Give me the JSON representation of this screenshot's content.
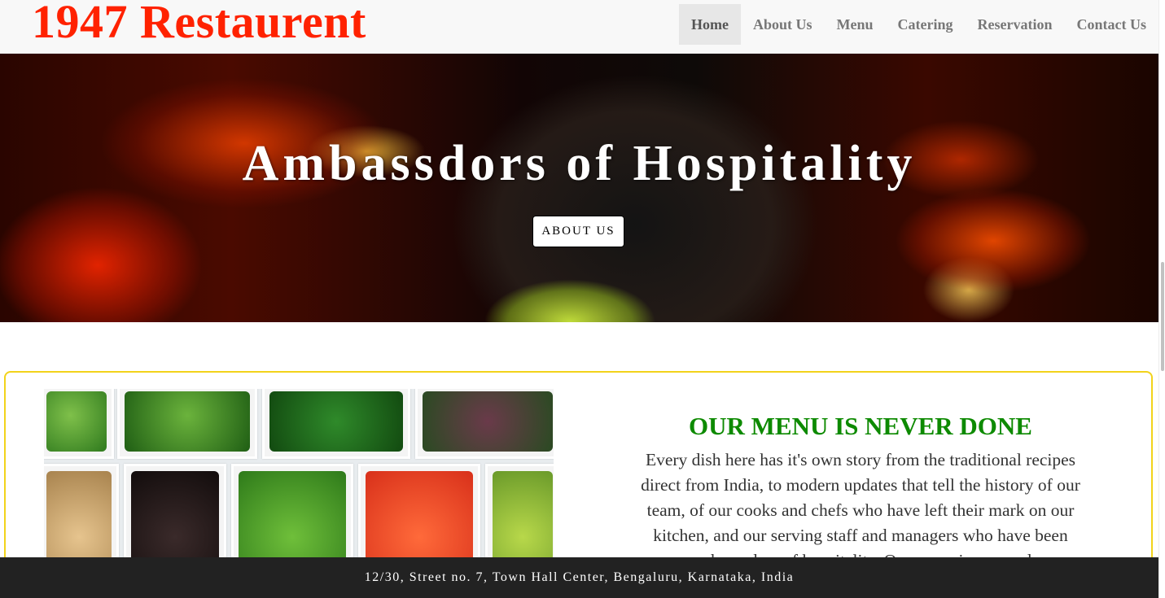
{
  "brand": {
    "name": "1947 Restaurent"
  },
  "nav": {
    "items": [
      {
        "label": "Home",
        "active": true
      },
      {
        "label": "About Us"
      },
      {
        "label": "Menu"
      },
      {
        "label": "Catering"
      },
      {
        "label": "Reservation"
      },
      {
        "label": "Contact Us"
      }
    ]
  },
  "hero": {
    "title": "Ambassdors of Hospitality",
    "button_label": "ABOUT US"
  },
  "menu_section": {
    "heading": "OUR MENU IS NEVER DONE",
    "text": "Every dish here has it's own story from the traditional recipes direct from India, to modern updates that tell the history of our team, of our cooks and chefs who have left their mark on our kitchen, and our serving staff and managers who have been ambassadors of hospitality. Our menu is a record"
  },
  "footer": {
    "address": "12/30, Street no. 7, Town Hall Center, Bengaluru, Karnataka, India"
  },
  "colors": {
    "brand": "#ff2200",
    "menu_heading": "#0d8a00",
    "section_border": "#f2d31b",
    "footer_bg": "#222222"
  }
}
